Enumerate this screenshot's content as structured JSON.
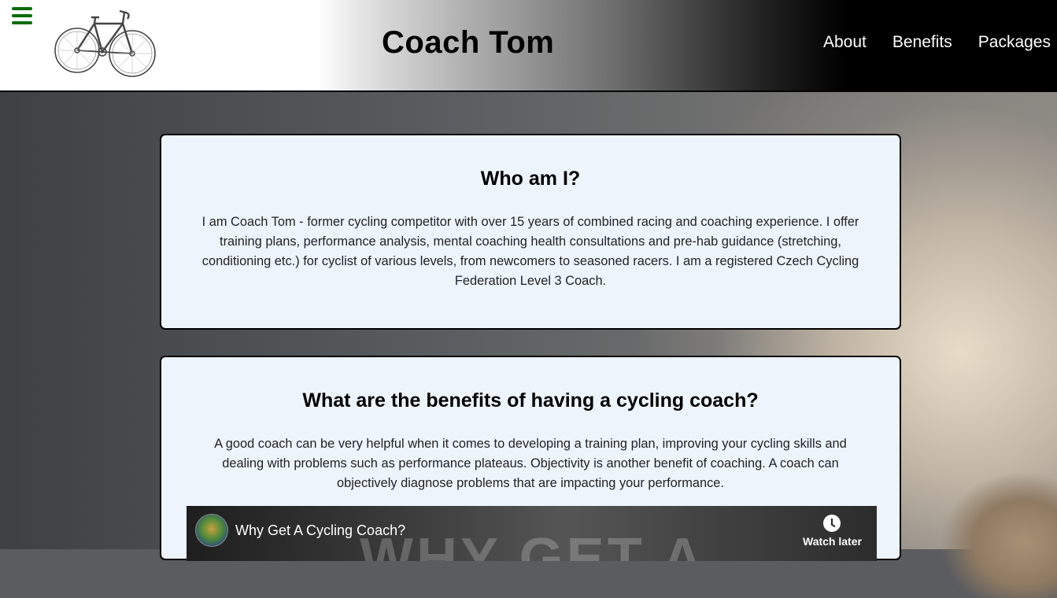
{
  "header": {
    "title": "Coach Tom",
    "nav": [
      "About",
      "Benefits",
      "Packages"
    ]
  },
  "about": {
    "heading": "Who am I?",
    "text": "I am Coach Tom - former cycling competitor with over 15 years of combined racing and coaching experience. I offer training plans, performance analysis, mental coaching health consultations and pre-hab guidance (stretching, conditioning etc.) for cyclist of various levels, from newcomers to seasoned racers. I am a registered Czech Cycling Federation Level 3 Coach."
  },
  "benefits": {
    "heading": "What are the benefits of having a cycling coach?",
    "text": "A good coach can be very helpful when it comes to developing a training plan, improving your cycling skills and dealing with problems such as performance plateaus. Objectivity is another benefit of coaching. A coach can objectively diagnose problems that are impacting your performance.",
    "video": {
      "title": "Why Get A Cycling Coach?",
      "overlay_text": "WHY GET A",
      "watch_later": "Watch later"
    }
  },
  "colors": {
    "hamburger": "#0a6b0a",
    "card_bg": "#edf4fc"
  },
  "icons": {
    "menu": "hamburger-menu-icon",
    "logo": "bicycle-logo",
    "watch_later": "clock-icon"
  }
}
